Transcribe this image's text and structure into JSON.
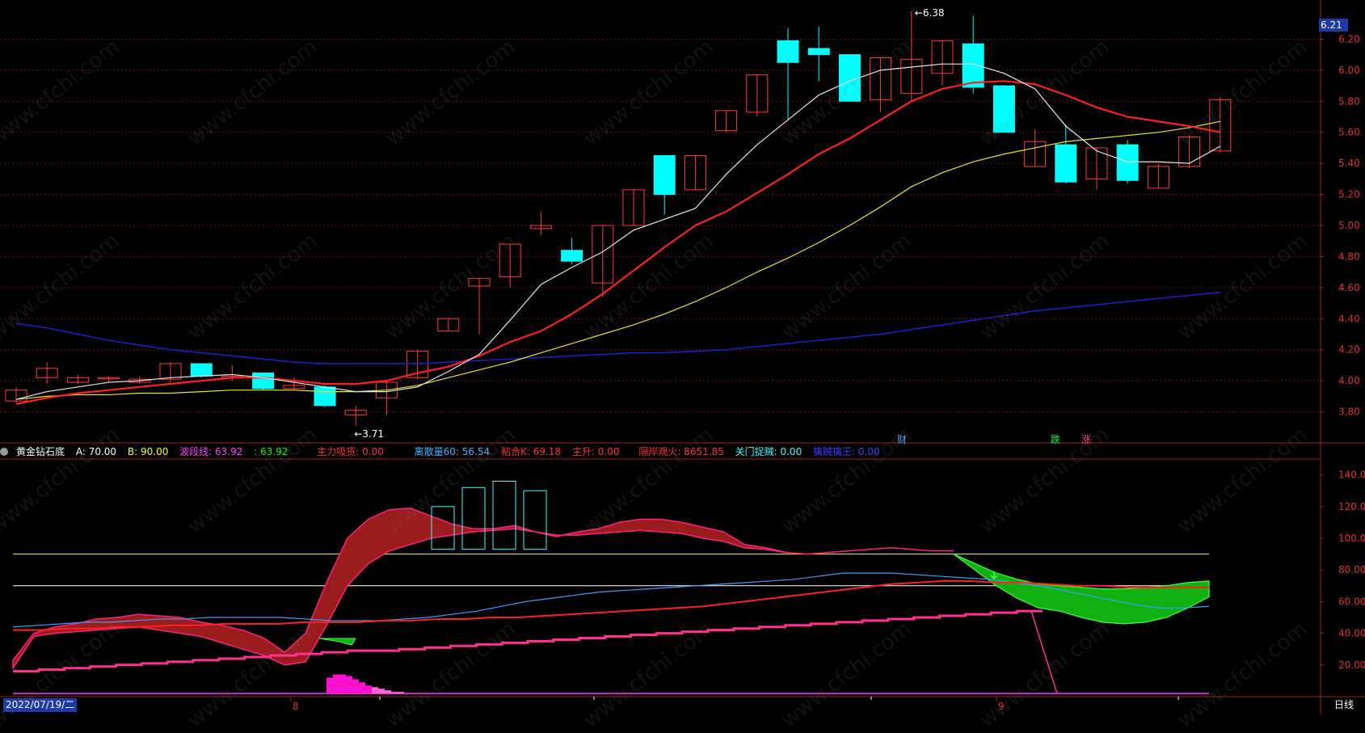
{
  "watermark": "www.cfchi.com",
  "price_tag": "6.21",
  "annotations": {
    "high": "6.38",
    "low": "3.71"
  },
  "event_marks": [
    {
      "label": "财",
      "color": "#3fa0ff"
    },
    {
      "label": "跌",
      "color": "#00ff40"
    },
    {
      "label": "涨",
      "color": "#ff4080"
    }
  ],
  "indicator": {
    "name": "黄金钻石底",
    "items": [
      {
        "label": "A: 70.00",
        "color": "#ffffff"
      },
      {
        "label": "B: 90.00",
        "color": "#ffff00"
      },
      {
        "label": "波段线: 63.92",
        "color": "#ff40ff"
      },
      {
        "label": ": 63.92",
        "color": "#00ff00"
      },
      {
        "label": "主力吸货: 0.00",
        "color": "#ff3030"
      },
      {
        "label": "离散量60: 56.54",
        "color": "#40b0ff"
      },
      {
        "label": "粘合K: 69.18",
        "color": "#ff3030"
      },
      {
        "label": "主升: 0.00",
        "color": "#ff3030"
      },
      {
        "label": "隔岸观火: 8651.85",
        "color": "#ff3030"
      },
      {
        "label": "关门捉贼: 0.00",
        "color": "#40ffff"
      },
      {
        "label": "擒贼擒王: 0.00",
        "color": "#4040ff"
      }
    ]
  },
  "footer": {
    "date": "2022/07/19/二",
    "period": "日线",
    "axis_labels": [
      "8",
      "9"
    ]
  },
  "chart_data": [
    {
      "type": "candlestick",
      "ylim": [
        3.6,
        6.4
      ],
      "yticks": [
        "3.80",
        "4.00",
        "4.20",
        "4.40",
        "4.60",
        "4.80",
        "5.00",
        "5.20",
        "5.40",
        "5.60",
        "5.80",
        "6.00",
        "6.20"
      ],
      "colors": {
        "up": "#ff3b3b",
        "down": "#00ffff",
        "ma5": "#e8e8e8",
        "ma10": "#ff2020",
        "ma20": "#e8e820",
        "ma60": "#2020d0"
      },
      "candles": [
        [
          3.87,
          3.94,
          3.86,
          3.96
        ],
        [
          4.02,
          4.08,
          3.98,
          4.12
        ],
        [
          3.99,
          4.02,
          3.98,
          4.04
        ],
        [
          4.02,
          4.02,
          3.99,
          4.03
        ],
        [
          3.99,
          4.01,
          3.98,
          4.03
        ],
        [
          4.01,
          4.11,
          3.99,
          4.12
        ],
        [
          4.11,
          4.03,
          4.02,
          4.11
        ],
        [
          4.02,
          4.03,
          4.0,
          4.1
        ],
        [
          4.05,
          3.95,
          3.94,
          4.05
        ],
        [
          3.95,
          3.97,
          3.94,
          4.02
        ],
        [
          3.96,
          3.84,
          3.83,
          3.97
        ],
        [
          3.78,
          3.81,
          3.71,
          3.84
        ],
        [
          3.89,
          3.99,
          3.78,
          4.0
        ],
        [
          4.02,
          4.19,
          4.01,
          4.2
        ],
        [
          4.32,
          4.4,
          4.32,
          4.4
        ],
        [
          4.61,
          4.66,
          4.3,
          4.66
        ],
        [
          4.67,
          4.88,
          4.6,
          4.88
        ],
        [
          4.98,
          5.0,
          4.94,
          5.09
        ],
        [
          4.84,
          4.77,
          4.75,
          4.92
        ],
        [
          4.63,
          5.0,
          4.54,
          5.0
        ],
        [
          5.0,
          5.23,
          5.0,
          5.23
        ],
        [
          5.45,
          5.2,
          5.07,
          5.45
        ],
        [
          5.23,
          5.45,
          5.23,
          5.45
        ],
        [
          5.61,
          5.74,
          5.6,
          5.74
        ],
        [
          5.73,
          5.97,
          5.7,
          5.97
        ],
        [
          6.19,
          6.05,
          5.68,
          6.27
        ],
        [
          6.14,
          6.1,
          5.93,
          6.28
        ],
        [
          6.1,
          5.8,
          5.8,
          6.1
        ],
        [
          5.81,
          6.08,
          5.73,
          6.08
        ],
        [
          5.85,
          6.07,
          5.8,
          6.38
        ],
        [
          5.98,
          6.19,
          5.9,
          6.19
        ],
        [
          6.17,
          5.89,
          5.85,
          6.35
        ],
        [
          5.9,
          5.6,
          5.6,
          5.9
        ],
        [
          5.38,
          5.54,
          5.38,
          5.62
        ],
        [
          5.52,
          5.28,
          5.27,
          5.65
        ],
        [
          5.3,
          5.5,
          5.23,
          5.5
        ],
        [
          5.52,
          5.29,
          5.27,
          5.55
        ],
        [
          5.24,
          5.38,
          5.24,
          5.4
        ],
        [
          5.38,
          5.57,
          5.37,
          5.58
        ],
        [
          5.48,
          5.81,
          5.47,
          5.83
        ]
      ],
      "ma5": [
        3.88,
        3.93,
        3.96,
        3.99,
        4.0,
        4.02,
        4.03,
        4.04,
        4.02,
        3.99,
        3.96,
        3.93,
        3.93,
        3.96,
        4.06,
        4.17,
        4.39,
        4.62,
        4.73,
        4.83,
        4.97,
        5.04,
        5.11,
        5.33,
        5.52,
        5.68,
        5.84,
        5.93,
        6.0,
        6.02,
        6.04,
        6.04,
        5.98,
        5.88,
        5.64,
        5.48,
        5.41,
        5.41,
        5.4,
        5.51
      ],
      "ma10": [
        3.85,
        3.89,
        3.92,
        3.94,
        3.96,
        3.98,
        4.0,
        4.02,
        4.02,
        4.0,
        3.98,
        3.98,
        4.0,
        4.05,
        4.09,
        4.16,
        4.25,
        4.32,
        4.43,
        4.56,
        4.71,
        4.86,
        5.0,
        5.09,
        5.21,
        5.33,
        5.46,
        5.56,
        5.68,
        5.8,
        5.88,
        5.92,
        5.93,
        5.91,
        5.84,
        5.76,
        5.7,
        5.67,
        5.64,
        5.6
      ],
      "ma20": [
        3.88,
        3.9,
        3.91,
        3.91,
        3.92,
        3.92,
        3.93,
        3.94,
        3.94,
        3.94,
        3.93,
        3.93,
        3.94,
        3.97,
        4.02,
        4.07,
        4.12,
        4.18,
        4.24,
        4.3,
        4.36,
        4.43,
        4.51,
        4.6,
        4.7,
        4.79,
        4.89,
        5.0,
        5.12,
        5.25,
        5.34,
        5.41,
        5.46,
        5.5,
        5.54,
        5.56,
        5.58,
        5.6,
        5.63,
        5.67
      ],
      "ma60": [
        4.37,
        4.34,
        4.3,
        4.26,
        4.23,
        4.2,
        4.18,
        4.16,
        4.14,
        4.12,
        4.11,
        4.11,
        4.11,
        4.11,
        4.12,
        4.13,
        4.14,
        4.15,
        4.16,
        4.17,
        4.18,
        4.18,
        4.19,
        4.2,
        4.22,
        4.24,
        4.26,
        4.28,
        4.3,
        4.33,
        4.36,
        4.39,
        4.42,
        4.45,
        4.47,
        4.49,
        4.51,
        4.53,
        4.55,
        4.57
      ]
    },
    {
      "type": "line",
      "ylim": [
        0,
        150
      ],
      "yticks": [
        "20.00",
        "40.00",
        "60.00",
        "80.00",
        "100.00",
        "120.00",
        "140.00"
      ],
      "levels": {
        "A": 70,
        "B": 90
      },
      "band_upper": [
        23,
        40,
        44,
        46,
        49,
        50,
        52,
        51,
        50,
        47,
        45,
        42,
        37,
        28,
        40,
        72,
        100,
        112,
        118,
        119,
        114,
        109,
        106,
        106,
        108,
        104,
        101,
        104,
        106,
        110,
        112,
        112,
        110,
        107,
        104,
        96,
        94,
        91,
        90,
        91,
        92,
        93,
        94,
        93,
        92,
        92
      ],
      "band_lower": [
        18,
        38,
        40,
        41,
        42,
        43,
        44,
        42,
        40,
        38,
        34,
        30,
        26,
        20,
        22,
        45,
        70,
        84,
        92,
        96,
        100,
        102,
        104,
        105,
        106,
        104,
        102,
        102,
        103,
        104,
        105,
        104,
        103,
        100,
        98,
        94,
        93,
        91,
        90,
        91,
        92,
        93,
        94,
        93,
        92,
        92
      ],
      "discrete60": [
        44,
        45,
        46,
        47,
        47,
        48,
        49,
        49,
        50,
        50,
        50,
        50,
        49,
        48,
        48,
        48,
        49,
        50,
        52,
        54,
        57,
        60,
        62,
        64,
        66,
        67,
        68,
        69,
        70,
        71,
        72,
        73,
        74,
        76,
        78,
        78,
        78,
        77,
        76,
        75,
        74,
        72,
        70,
        67,
        64,
        61,
        58,
        56,
        56,
        57
      ],
      "glue_k": [
        42,
        42,
        43,
        43,
        44,
        44,
        45,
        45,
        46,
        46,
        46,
        47,
        47,
        47,
        48,
        48,
        49,
        49,
        50,
        50,
        51,
        52,
        53,
        54,
        55,
        56,
        57,
        59,
        61,
        63,
        65,
        67,
        69,
        71,
        72,
        73,
        73,
        72,
        72,
        71,
        70,
        70,
        69,
        69,
        69,
        69
      ],
      "wave": [
        16,
        17,
        18,
        19,
        20,
        21,
        22,
        23,
        24,
        25,
        26,
        27,
        28,
        29,
        29,
        30,
        31,
        32,
        33,
        34,
        35,
        36,
        37,
        38,
        39,
        40,
        41,
        42,
        43,
        44,
        45,
        46,
        47,
        48,
        49,
        50,
        51,
        52,
        53,
        54,
        5,
        5,
        5,
        5,
        5
      ],
      "green_upper": [
        90,
        84,
        78,
        74,
        71,
        70,
        69,
        68,
        68,
        69,
        70,
        72,
        73
      ],
      "green_lower": [
        90,
        80,
        70,
        62,
        56,
        54,
        50,
        47,
        46,
        47,
        50,
        56,
        63
      ],
      "pink_bars": [
        12,
        14,
        14,
        13,
        11,
        9,
        7,
        6,
        5,
        4,
        3,
        3,
        2,
        2,
        2
      ],
      "magenta_base": 2
    }
  ]
}
